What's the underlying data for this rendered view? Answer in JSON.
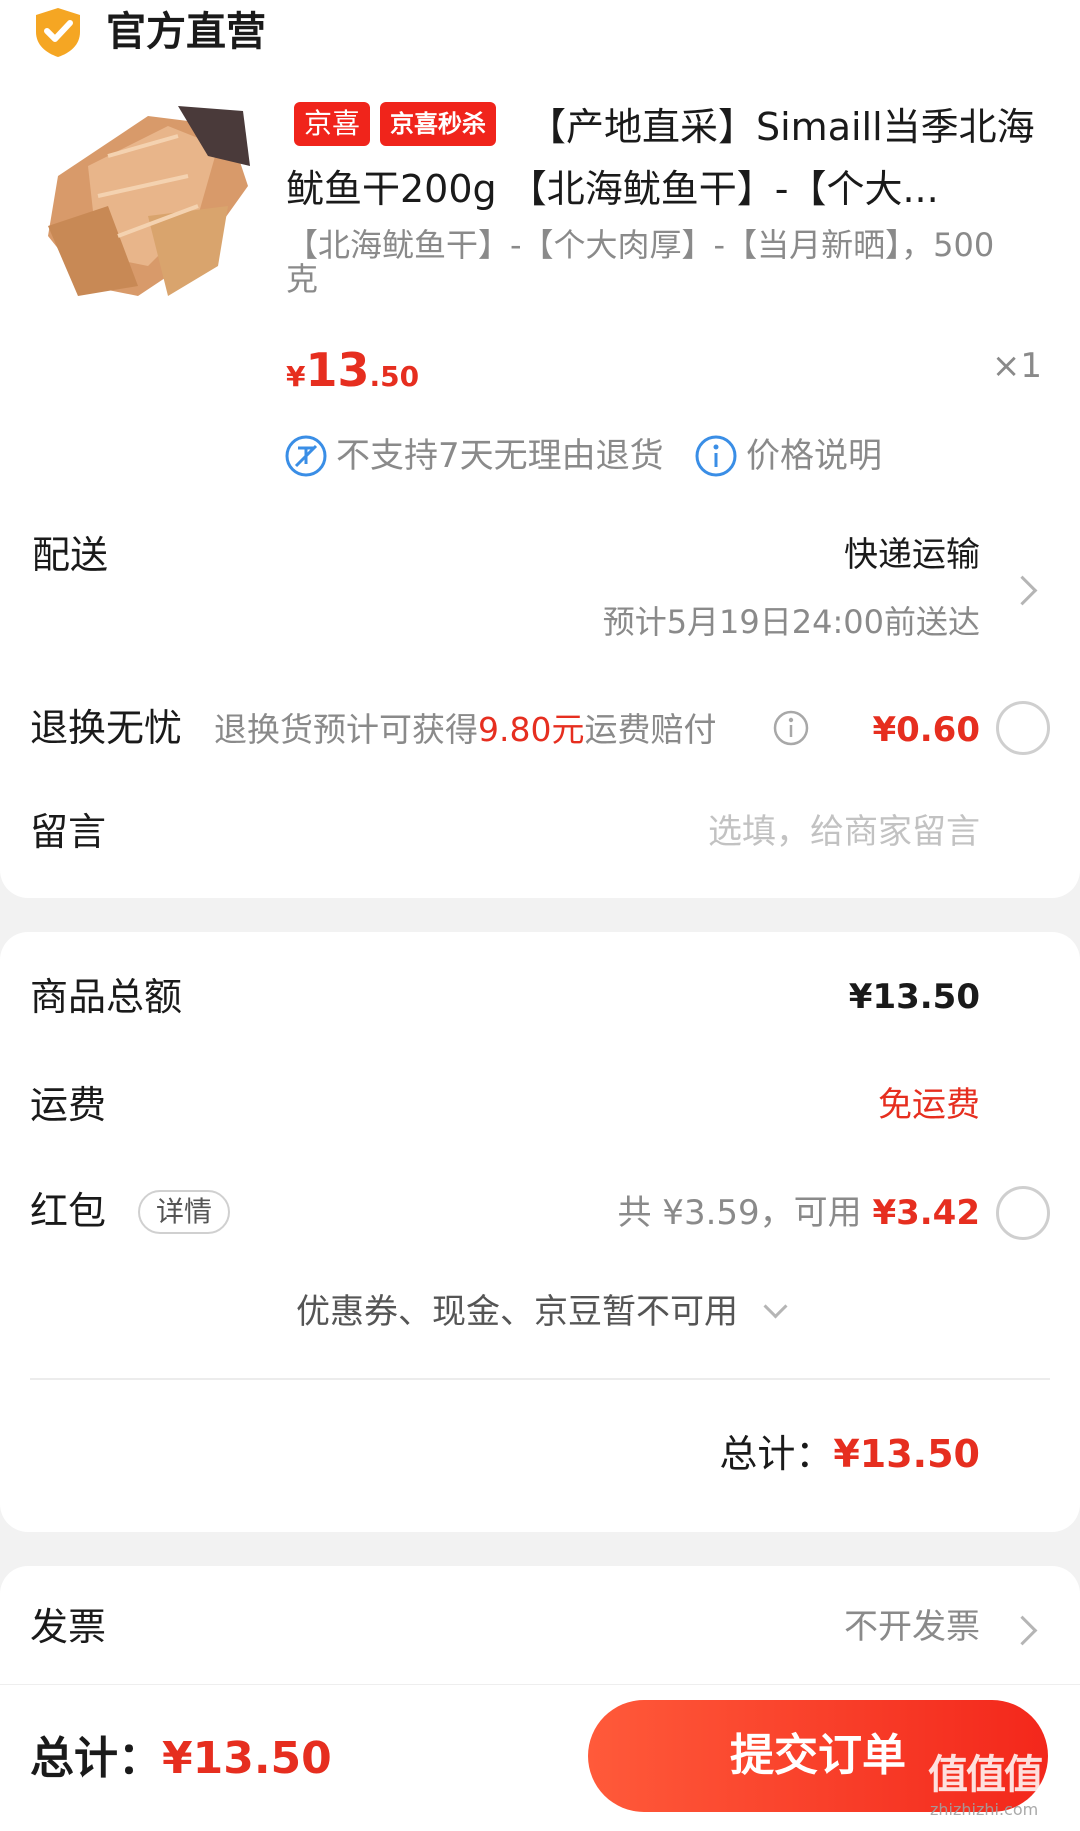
{
  "shop": {
    "name": "官方直营"
  },
  "product": {
    "tags": [
      "京喜",
      "京喜秒杀"
    ],
    "title": "【产地直采】Simaill当季北海鱿鱼干200g 【北海鱿鱼干】-【个大...",
    "spec": "【北海鱿鱼干】-【个大肉厚】-【当月新晒】，500克",
    "price_symbol": "¥",
    "price_int": "13",
    "price_dec": ".50",
    "quantity": "×1",
    "no_return": "不支持7天无理由退货",
    "price_note": "价格说明"
  },
  "delivery": {
    "label": "配送",
    "method": "快递运输",
    "eta": "预计5月19日24:00前送达"
  },
  "return_insurance": {
    "label": "退换无忧",
    "desc_prefix": "退换货预计可获得",
    "desc_amount": "9.80元",
    "desc_suffix": "运费赔付",
    "price": "¥0.60"
  },
  "message": {
    "label": "留言",
    "placeholder": "选填，给商家留言"
  },
  "summary": {
    "goods_label": "商品总额",
    "goods_value": "¥13.50",
    "shipping_label": "运费",
    "shipping_value": "免运费",
    "redpack_label": "红包",
    "redpack_detail": "详情",
    "redpack_total": "共 ¥3.59，可用 ",
    "redpack_usable": "¥3.42",
    "unavailable": "优惠券、现金、京豆暂不可用",
    "total_label": "总计：",
    "total_value": "¥13.50"
  },
  "invoice": {
    "label": "发票",
    "value": "不开发票"
  },
  "bottom": {
    "total_label": "总计：",
    "total_value": "¥13.50",
    "submit": "提交订单"
  },
  "watermark": {
    "text": "值值值",
    "domain": "zhizhizhi.com"
  },
  "colors": {
    "accent": "#e62e1f",
    "shield": "#f5a623",
    "info_blue": "#3a8ee6"
  }
}
